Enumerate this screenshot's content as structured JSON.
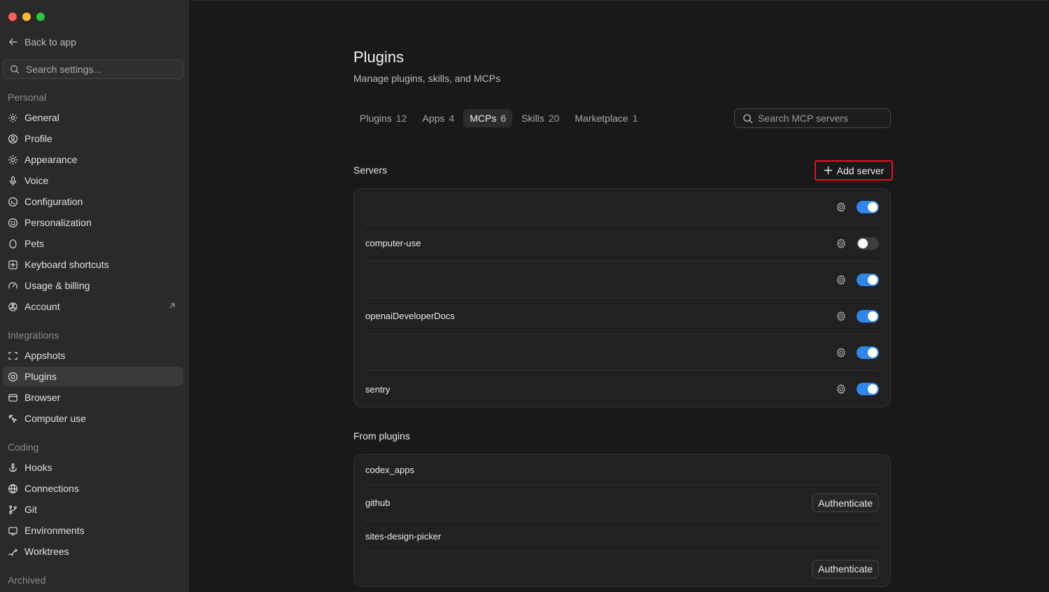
{
  "sidebar": {
    "back_label": "Back to app",
    "search_placeholder": "Search settings...",
    "sections": {
      "personal": "Personal",
      "integrations": "Integrations",
      "coding": "Coding",
      "archived": "Archived"
    },
    "personal_items": [
      "General",
      "Profile",
      "Appearance",
      "Voice",
      "Configuration",
      "Personalization",
      "Pets",
      "Keyboard shortcuts",
      "Usage & billing",
      "Account"
    ],
    "integration_items": [
      "Appshots",
      "Plugins",
      "Browser",
      "Computer use"
    ],
    "coding_items": [
      "Hooks",
      "Connections",
      "Git",
      "Environments",
      "Worktrees"
    ],
    "active_item": "Plugins"
  },
  "main": {
    "title": "Plugins",
    "subtitle": "Manage plugins, skills, and MCPs",
    "tabs": [
      {
        "label": "Plugins",
        "count": "12"
      },
      {
        "label": "Apps",
        "count": "4"
      },
      {
        "label": "MCPs",
        "count": "6"
      },
      {
        "label": "Skills",
        "count": "20"
      },
      {
        "label": "Marketplace",
        "count": "1"
      }
    ],
    "active_tab": "MCPs",
    "search_placeholder": "Search MCP servers",
    "servers_title": "Servers",
    "add_server_label": "Add server",
    "servers": [
      {
        "name": "",
        "enabled": true
      },
      {
        "name": "computer-use",
        "enabled": false
      },
      {
        "name": "",
        "enabled": true
      },
      {
        "name": "openaiDeveloperDocs",
        "enabled": true
      },
      {
        "name": "",
        "enabled": true
      },
      {
        "name": "sentry",
        "enabled": true
      }
    ],
    "from_plugins_title": "From plugins",
    "plugins": [
      {
        "name": "codex_apps",
        "action": ""
      },
      {
        "name": "github",
        "action": "Authenticate"
      },
      {
        "name": "sites-design-picker",
        "action": ""
      },
      {
        "name": "",
        "action": "Authenticate"
      }
    ]
  },
  "colors": {
    "toggle_on": "#2f86ec",
    "highlight_border": "#e0141f"
  }
}
